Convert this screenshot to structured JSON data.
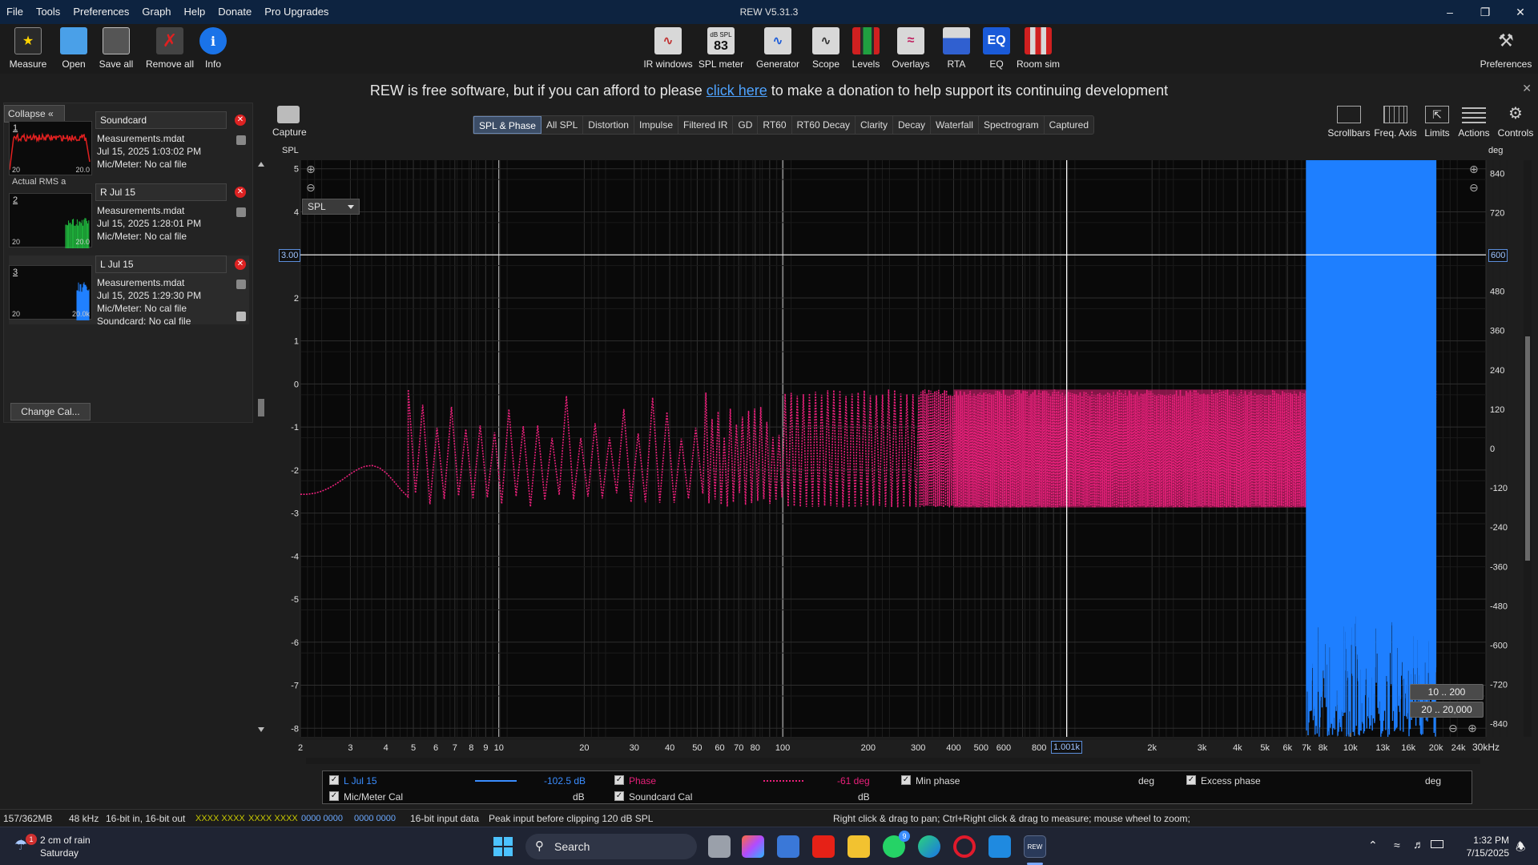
{
  "app": {
    "title": "REW V5.31.3",
    "menu": [
      "File",
      "Tools",
      "Preferences",
      "Graph",
      "Help",
      "Donate",
      "Pro Upgrades"
    ]
  },
  "toolbar": {
    "left": [
      {
        "label": "Measure",
        "icon": "measure-icon"
      },
      {
        "label": "Open",
        "icon": "folder-icon"
      },
      {
        "label": "Save all",
        "icon": "save-icon"
      },
      {
        "label": "Remove all",
        "icon": "remove-icon"
      },
      {
        "label": "Info",
        "icon": "info-icon"
      }
    ],
    "center": [
      {
        "label": "IR windows",
        "icon": "ir-windows-icon"
      },
      {
        "label": "SPL meter",
        "icon": "spl-meter-icon",
        "badge_top": "dB SPL",
        "badge_value": "83"
      },
      {
        "label": "Generator",
        "icon": "generator-icon"
      },
      {
        "label": "Scope",
        "icon": "scope-icon"
      },
      {
        "label": "Levels",
        "icon": "levels-icon"
      },
      {
        "label": "Overlays",
        "icon": "overlays-icon"
      },
      {
        "label": "RTA",
        "icon": "rta-icon"
      },
      {
        "label": "EQ",
        "icon": "eq-icon"
      },
      {
        "label": "Room sim",
        "icon": "room-sim-icon"
      }
    ],
    "right": {
      "label": "Preferences",
      "icon": "preferences-icon"
    }
  },
  "donate": {
    "before": "REW is free software, but if you can afford to please ",
    "link": "click here",
    "after": " to make a donation to help support its continuing development"
  },
  "panel": {
    "collapse_label": "Collapse",
    "change_cal_label": "Change Cal...",
    "measurements": [
      {
        "num": "1",
        "name": "Soundcard",
        "file": "Measurements.mdat",
        "date": "Jul 15, 2025 1:03:02 PM",
        "mic": "Mic/Meter: No cal file",
        "extra": "Actual RMS a",
        "t_left": "20",
        "t_right": "20.0",
        "trace_color": "#e02020"
      },
      {
        "num": "2",
        "name": "R Jul 15",
        "file": "Measurements.mdat",
        "date": "Jul 15, 2025 1:28:01 PM",
        "mic": "Mic/Meter: No cal file",
        "t_left": "20",
        "t_right": "20.0",
        "trace_color": "#20c040"
      },
      {
        "num": "3",
        "name": "L Jul 15",
        "file": "Measurements.mdat",
        "date": "Jul 15, 2025 1:29:30 PM",
        "mic": "Mic/Meter: No cal file",
        "soundcard": "Soundcard: No cal file",
        "t_left": "20",
        "t_right": "20.0k",
        "trace_color": "#2080ff"
      }
    ]
  },
  "graph": {
    "capture_label": "Capture",
    "tabs": [
      "SPL & Phase",
      "All SPL",
      "Distortion",
      "Impulse",
      "Filtered IR",
      "GD",
      "RT60",
      "RT60 Decay",
      "Clarity",
      "Decay",
      "Waterfall",
      "Spectrogram",
      "Captured"
    ],
    "active_tab": "SPL & Phase",
    "right_tools": [
      "Scrollbars",
      "Freq. Axis",
      "Limits",
      "Actions",
      "Controls"
    ],
    "spl_select": "SPL",
    "range_buttons": [
      "10 .. 200",
      "20 .. 20,000"
    ],
    "cursor_left": "3.00",
    "cursor_right": "600",
    "cursor_freq": "1.001k"
  },
  "chart_data": {
    "type": "line",
    "left_axis": {
      "title": "SPL",
      "ticks": [
        "5",
        "4",
        "3",
        "2",
        "1",
        "0",
        "-1",
        "-2",
        "-3",
        "-4",
        "-5",
        "-6",
        "-7",
        "-8"
      ],
      "ylim": [
        -8.2,
        5.2
      ]
    },
    "right_axis": {
      "title": "deg",
      "ticks": [
        "840",
        "720",
        "600",
        "480",
        "360",
        "240",
        "120",
        "0",
        "-120",
        "-240",
        "-360",
        "-480",
        "-600",
        "-720",
        "-840"
      ],
      "ylim": [
        -880,
        880
      ]
    },
    "x_axis": {
      "title": "",
      "unit": "30kHz",
      "scale": "log",
      "xlim": [
        2,
        30000
      ],
      "ticks": [
        {
          "v": 2,
          "t": "2"
        },
        {
          "v": 3,
          "t": "3"
        },
        {
          "v": 4,
          "t": "4"
        },
        {
          "v": 5,
          "t": "5"
        },
        {
          "v": 6,
          "t": "6"
        },
        {
          "v": 7,
          "t": "7"
        },
        {
          "v": 8,
          "t": "8"
        },
        {
          "v": 9,
          "t": "9"
        },
        {
          "v": 10,
          "t": "10"
        },
        {
          "v": 20,
          "t": "20"
        },
        {
          "v": 30,
          "t": "30"
        },
        {
          "v": 40,
          "t": "40"
        },
        {
          "v": 50,
          "t": "50"
        },
        {
          "v": 60,
          "t": "60"
        },
        {
          "v": 70,
          "t": "70"
        },
        {
          "v": 80,
          "t": "80"
        },
        {
          "v": 100,
          "t": "100"
        },
        {
          "v": 200,
          "t": "200"
        },
        {
          "v": 300,
          "t": "300"
        },
        {
          "v": 400,
          "t": "400"
        },
        {
          "v": 500,
          "t": "500"
        },
        {
          "v": 600,
          "t": "600"
        },
        {
          "v": 800,
          "t": "800"
        },
        {
          "v": 2000,
          "t": "2k"
        },
        {
          "v": 3000,
          "t": "3k"
        },
        {
          "v": 4000,
          "t": "4k"
        },
        {
          "v": 5000,
          "t": "5k"
        },
        {
          "v": 6000,
          "t": "6k"
        },
        {
          "v": 7000,
          "t": "7k"
        },
        {
          "v": 8000,
          "t": "8k"
        },
        {
          "v": 10000,
          "t": "10k"
        },
        {
          "v": 13000,
          "t": "13k"
        },
        {
          "v": 16000,
          "t": "16k"
        },
        {
          "v": 20000,
          "t": "20k"
        },
        {
          "v": 24000,
          "t": "24k"
        }
      ]
    },
    "grid": true,
    "cursor": {
      "freq": 1001,
      "spl": 3.0,
      "phase": 600
    },
    "series": [
      {
        "name": "L Jul 15",
        "axis": "left",
        "color": "#1e7fff",
        "band_start_hz": 7000,
        "band_end_hz": 20000,
        "min": -8.2,
        "max": 5.2
      },
      {
        "name": "Phase",
        "axis": "right",
        "color": "#e8207a",
        "style": "dotted",
        "min_deg": -180,
        "max_deg": 180,
        "start_hz": 2.0,
        "end_hz": 20000
      }
    ]
  },
  "legend": {
    "row1": [
      {
        "label": "L Jul 15",
        "value": "-102.5 dB",
        "color": "#3a8dff"
      },
      {
        "label": "Phase",
        "value": "-61 deg",
        "color": "#e8207a"
      },
      {
        "label": "Min phase",
        "unit": "deg"
      },
      {
        "label": "Excess phase",
        "unit": "deg"
      }
    ],
    "row2": [
      {
        "label": "Mic/Meter Cal",
        "unit": "dB"
      },
      {
        "label": "Soundcard Cal",
        "unit": "dB"
      }
    ]
  },
  "status": {
    "memory": "157/362MB",
    "rate": "48 kHz",
    "bits": "16-bit in, 16-bit out",
    "meter1": "XXXX XXXX",
    "meter2": "XXXX XXXX",
    "meter3": "0000 0000",
    "meter4": "0000 0000",
    "input": "16-bit input data",
    "peak": "Peak input before clipping 120 dB SPL",
    "hint": "Right click & drag to pan; Ctrl+Right click & drag to measure; mouse wheel to zoom;"
  },
  "taskbar": {
    "weather_line1": "2 cm of rain",
    "weather_line2": "Saturday",
    "weather_badge": "1",
    "search_placeholder": "Search",
    "whatsapp_badge": "9",
    "time": "1:32 PM",
    "date": "7/15/2025"
  }
}
